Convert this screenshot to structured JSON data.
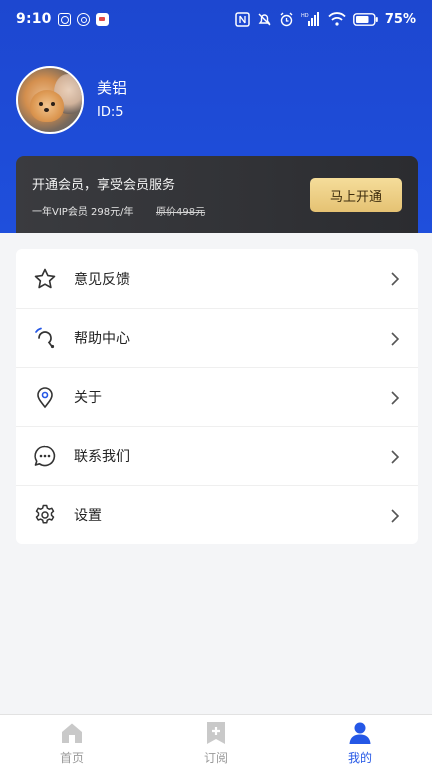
{
  "status_bar": {
    "time": "9:10",
    "signal_label": "HD",
    "battery_percent": "75%"
  },
  "profile": {
    "name": "美铝",
    "id_text": "ID:5"
  },
  "vip": {
    "title": "开通会员，享受会员服务",
    "price_text": "一年VIP会员 298元/年",
    "original_price_text": "原价498元",
    "button_label": "马上开通"
  },
  "menu": {
    "items": [
      {
        "label": "意见反馈",
        "icon": "star-icon"
      },
      {
        "label": "帮助中心",
        "icon": "headset-icon"
      },
      {
        "label": "关于",
        "icon": "location-pin-icon"
      },
      {
        "label": "联系我们",
        "icon": "chat-bubble-icon"
      },
      {
        "label": "设置",
        "icon": "gear-icon"
      }
    ]
  },
  "tabbar": {
    "tabs": [
      {
        "label": "首页",
        "icon": "home-icon",
        "active": false
      },
      {
        "label": "订阅",
        "icon": "subscribe-icon",
        "active": false
      },
      {
        "label": "我的",
        "icon": "user-icon",
        "active": true
      }
    ]
  },
  "colors": {
    "header_blue": "#1f4fdc",
    "active_tab": "#2457e6",
    "vip_card": "#2f3034",
    "vip_button_gold": "#e5c273",
    "background": "#f4f5f7"
  }
}
